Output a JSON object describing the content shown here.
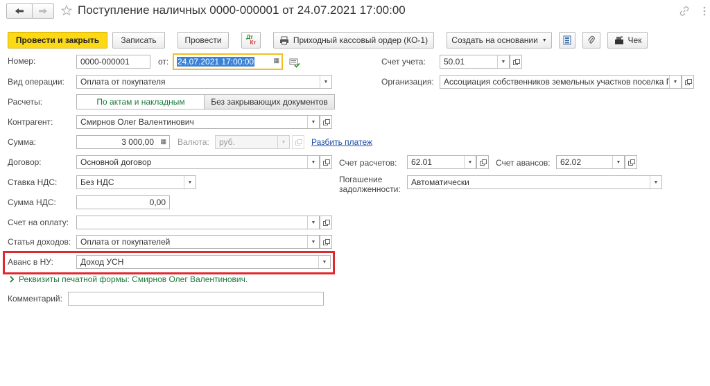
{
  "header": {
    "title": "Поступление наличных 0000-000001 от 24.07.2021 17:00:00"
  },
  "toolbar": {
    "post_close": "Провести и закрыть",
    "save": "Записать",
    "post": "Провести",
    "dtkt_top": "Дт",
    "dtkt_bottom": "Кт",
    "print_order": "Приходный кассовый ордер (КО-1)",
    "create_based": "Создать на основании",
    "check": "Чек"
  },
  "form": {
    "number_label": "Номер:",
    "number_value": "0000-000001",
    "date_label": "от:",
    "date_value": "24.07.2021 17:00:00",
    "account_label": "Счет учета:",
    "account_value": "50.01",
    "op_type_label": "Вид операции:",
    "op_type_value": "Оплата от покупателя",
    "org_label": "Организация:",
    "org_value": "Ассоциация собственников земельных участков поселка Г",
    "settlements_label": "Расчеты:",
    "settlements_option1": "По актам и накладным",
    "settlements_option2": "Без закрывающих документов",
    "counterparty_label": "Контрагент:",
    "counterparty_value": "Смирнов Олег Валентинович",
    "amount_label": "Сумма:",
    "amount_value": "3 000,00",
    "currency_label": "Валюта:",
    "currency_value": "руб.",
    "split_payment": "Разбить платеж",
    "contract_label": "Договор:",
    "contract_value": "Основной договор",
    "settle_account_label": "Счет расчетов:",
    "settle_account_value": "62.01",
    "advance_account_label": "Счет авансов:",
    "advance_account_value": "62.02",
    "vat_rate_label": "Ставка НДС:",
    "vat_rate_value": "Без НДС",
    "debt_repay_label_1": "Погашение",
    "debt_repay_label_2": "задолженности:",
    "debt_repay_value": "Автоматически",
    "vat_amount_label": "Сумма НДС:",
    "vat_amount_value": "0,00",
    "invoice_label": "Счет на оплату:",
    "invoice_value": "",
    "income_item_label": "Статья доходов:",
    "income_item_value": "Оплата от покупателей",
    "advance_nu_label": "Аванс в НУ:",
    "advance_nu_value": "Доход УСН",
    "print_form_details": "Реквизиты печатной формы: Смирнов Олег Валентинович.",
    "comment_label": "Комментарий:",
    "comment_value": ""
  },
  "colors": {
    "accent_yellow": "#fcd815",
    "link_blue": "#1d4ca3",
    "green_text": "#1a7a3a",
    "highlight_red": "#e0282e",
    "date_focus": "#f0c020",
    "selection_blue": "#3b82d6"
  }
}
